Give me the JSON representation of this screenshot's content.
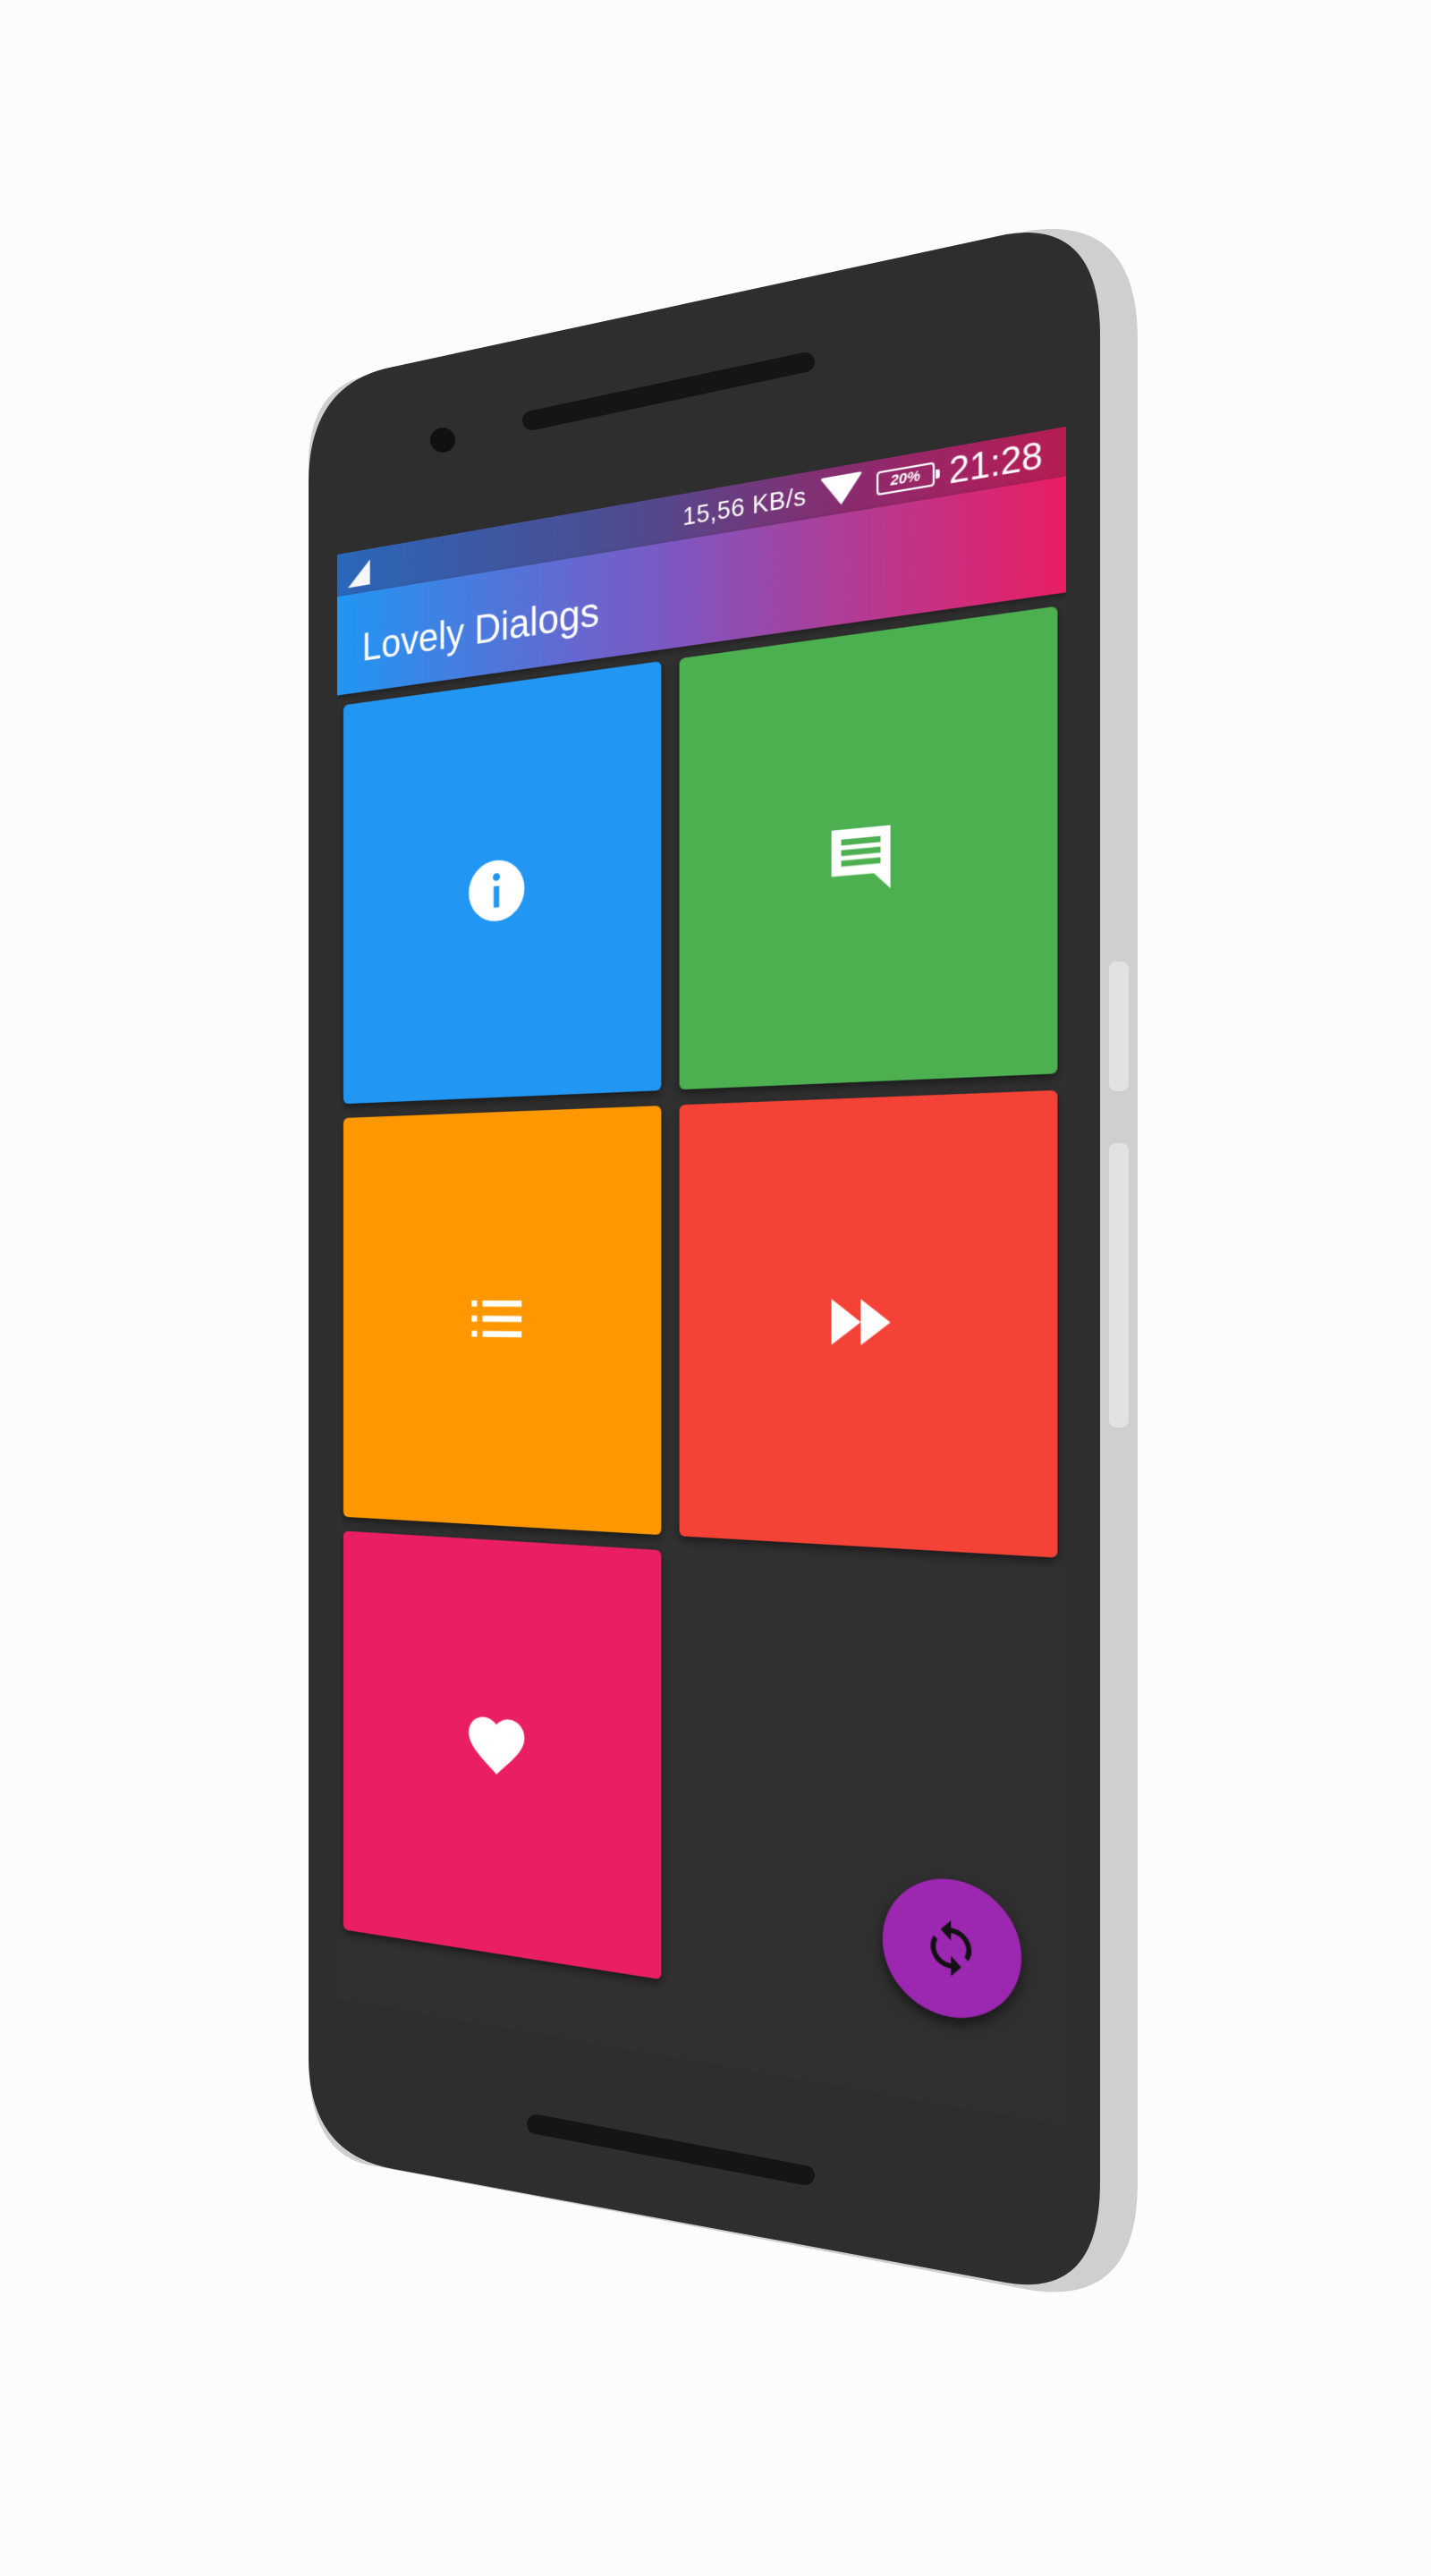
{
  "status_bar": {
    "network_speed": "15,56  KB/s",
    "battery_level": "20%",
    "time": "21:28",
    "signal_icon": "cell-signal-icon",
    "wifi_icon": "wifi-icon",
    "battery_icon": "battery-icon"
  },
  "app_bar": {
    "title": "Lovely Dialogs",
    "gradient_colors": [
      "#2196f3",
      "#7e57c2",
      "#e91e63"
    ]
  },
  "tiles": [
    {
      "id": "info",
      "icon": "info-icon",
      "color": "#2196f3"
    },
    {
      "id": "standard",
      "icon": "message-icon",
      "color": "#4caf50"
    },
    {
      "id": "choice",
      "icon": "list-icon",
      "color": "#ff9800"
    },
    {
      "id": "progress",
      "icon": "fast-forward-icon",
      "color": "#f44336"
    },
    {
      "id": "custom",
      "icon": "heart-icon",
      "color": "#e91e63"
    }
  ],
  "fab": {
    "icon": "refresh-icon",
    "color": "#9c27b0"
  },
  "theme": {
    "screen_background": "#303030",
    "phone_body": "#2e2e2e",
    "phone_rim": "#d0d0d0"
  }
}
